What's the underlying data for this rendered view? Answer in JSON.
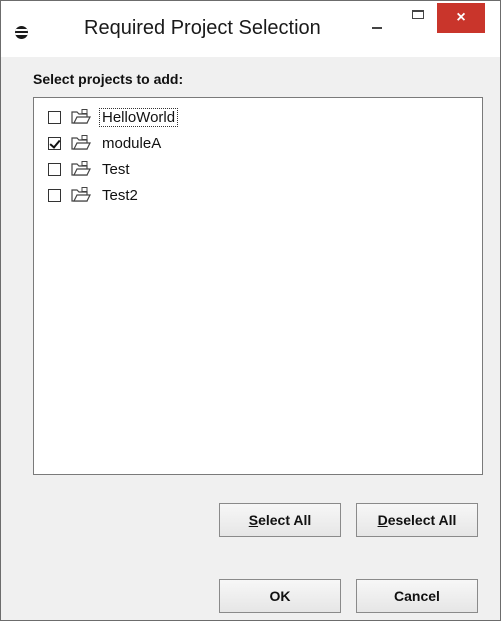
{
  "window": {
    "title": "Required Project Selection",
    "close_glyph": "×"
  },
  "prompt": "Select projects to add:",
  "projects": [
    {
      "label": "HelloWorld",
      "checked": false,
      "focused": true
    },
    {
      "label": "moduleA",
      "checked": true,
      "focused": false
    },
    {
      "label": "Test",
      "checked": false,
      "focused": false
    },
    {
      "label": "Test2",
      "checked": false,
      "focused": false
    }
  ],
  "buttons": {
    "select_all": {
      "mnemonic": "S",
      "rest": "elect All"
    },
    "deselect_all": {
      "mnemonic": "D",
      "rest": "eselect All"
    },
    "ok": "OK",
    "cancel": "Cancel"
  },
  "icons": {
    "app": "eclipse-icon",
    "project": "project-folder-icon"
  }
}
